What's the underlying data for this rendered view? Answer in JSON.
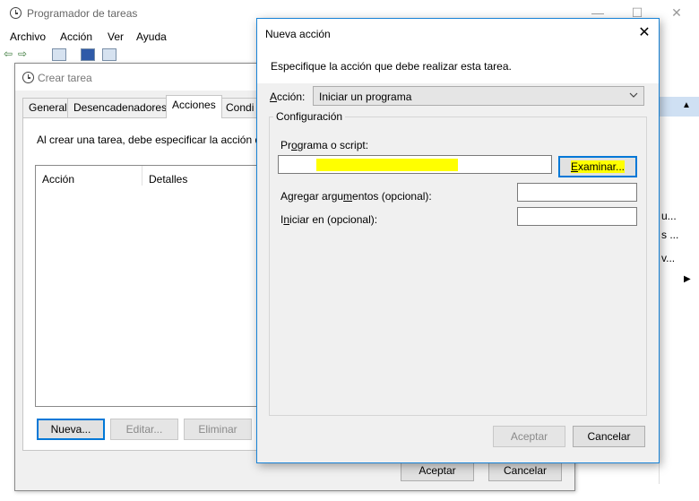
{
  "main_window": {
    "title": "Programador de tareas",
    "controls": {
      "minimize": "—",
      "maximize": "☐",
      "close": "✕"
    },
    "menu": [
      "Archivo",
      "Acción",
      "Ver",
      "Ayuda"
    ],
    "right_pane": {
      "items": [
        "u...",
        "s ...",
        "v..."
      ],
      "collapse_arrow": "▲",
      "expand_arrow": "▶"
    }
  },
  "crear_tarea": {
    "title": "Crear tarea",
    "tabs": [
      "General",
      "Desencadenadores",
      "Acciones",
      "Condi"
    ],
    "active_tab": "Acciones",
    "description": "Al crear una tarea, debe especificar la acción qu",
    "list_columns": [
      "Acción",
      "Detalles"
    ],
    "buttons": {
      "nueva": "Nueva...",
      "editar": "Editar...",
      "eliminar": "Eliminar"
    },
    "footer": {
      "aceptar": "Aceptar",
      "cancelar": "Cancelar"
    }
  },
  "nueva_accion": {
    "title": "Nueva acción",
    "subhead": "Especifique la acción que debe realizar esta tarea.",
    "accion_label_u": "A",
    "accion_label_rest": "cción:",
    "accion_value": "Iniciar un programa",
    "config_legend": "Configuración",
    "programa_label_a": "Pr",
    "programa_label_u": "o",
    "programa_label_b": "grama o script:",
    "programa_value": "",
    "examinar_u": "E",
    "examinar_rest": "xaminar...",
    "args_label_a": "Agregar argu",
    "args_label_u": "m",
    "args_label_b": "entos (opcional):",
    "iniciar_label_a": "I",
    "iniciar_label_u": "n",
    "iniciar_label_b": "iciar en (opcional):",
    "aceptar": "Aceptar",
    "cancelar": "Cancelar",
    "close_glyph": "✕",
    "highlight_color": "#ffff00"
  }
}
